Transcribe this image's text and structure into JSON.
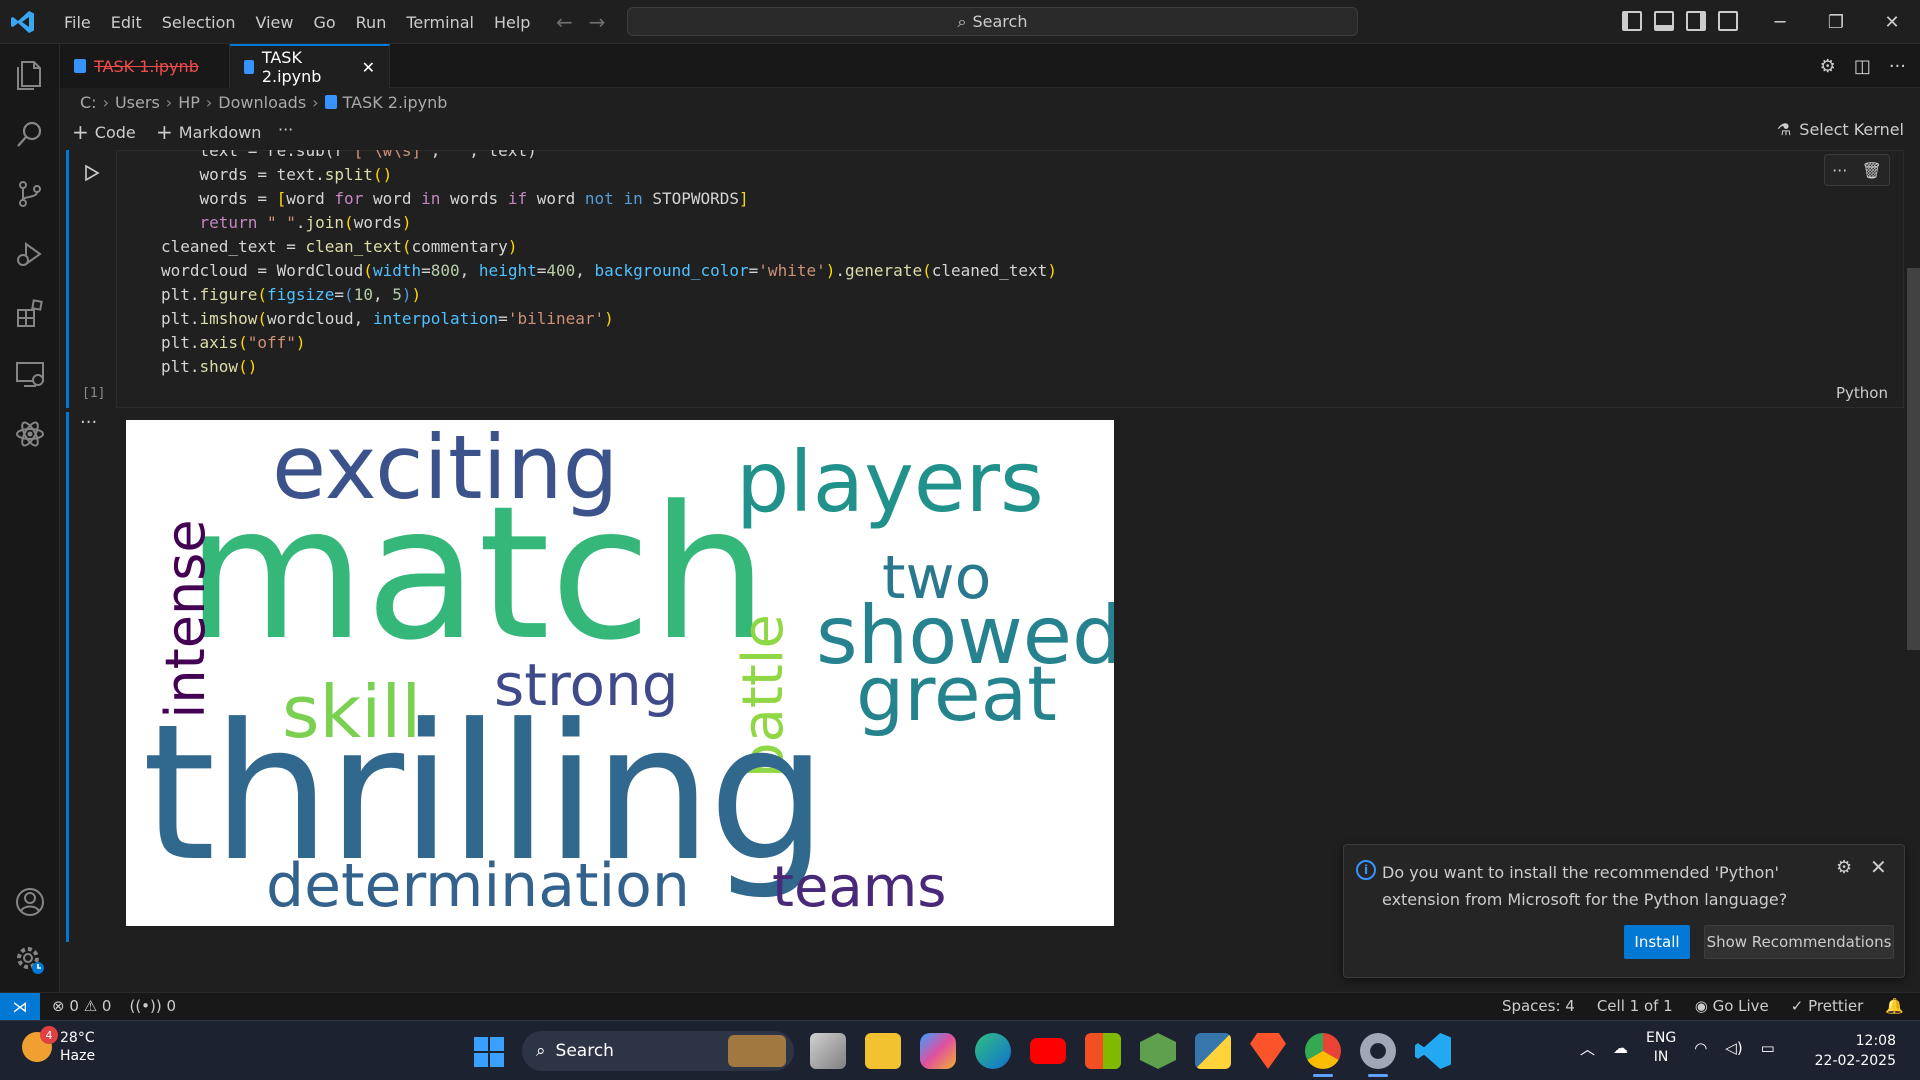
{
  "titlebar": {
    "menu": [
      "File",
      "Edit",
      "Selection",
      "View",
      "Go",
      "Run",
      "Terminal",
      "Help"
    ],
    "search_label": "Search"
  },
  "tabs": [
    {
      "label": "TASK 1.ipynb",
      "state": "error"
    },
    {
      "label": "TASK 2.ipynb",
      "state": "active"
    }
  ],
  "breadcrumb": [
    "C:",
    "Users",
    "HP",
    "Downloads",
    "TASK 2.ipynb"
  ],
  "toolbar": {
    "code_label": "Code",
    "markdown_label": "Markdown",
    "more_label": "···",
    "kernel_label": "Select Kernel"
  },
  "cell": {
    "exec_count": "[1]",
    "language": "Python",
    "code_lines": [
      "    text = re.sub(r'[^\\w\\s]', '', text)",
      "    words = text.split()",
      "    words = [word for word in words if word not in STOPWORDS]",
      "    return \" \".join(words)",
      "cleaned_text = clean_text(commentary)",
      "wordcloud = WordCloud(width=800, height=400, background_color='white').generate(cleaned_text)",
      "plt.figure(figsize=(10, 5))",
      "plt.imshow(wordcloud, interpolation='bilinear')",
      "plt.axis(\"off\")",
      "plt.show()"
    ]
  },
  "output": {
    "dots": "···",
    "wordcloud_words": [
      {
        "text": "match",
        "color": "#35b779"
      },
      {
        "text": "thrilling",
        "color": "#31688e"
      },
      {
        "text": "exciting",
        "color": "#3b528b"
      },
      {
        "text": "players",
        "color": "#21918c"
      },
      {
        "text": "showed",
        "color": "#26828e"
      },
      {
        "text": "two",
        "color": "#2a788e"
      },
      {
        "text": "great",
        "color": "#25838e"
      },
      {
        "text": "intense",
        "color": "#440154"
      },
      {
        "text": "strong",
        "color": "#3e4a89"
      },
      {
        "text": "skill",
        "color": "#7ad151"
      },
      {
        "text": "battle",
        "color": "#8fd744"
      },
      {
        "text": "determination",
        "color": "#33638d"
      },
      {
        "text": "teams",
        "color": "#482878"
      }
    ]
  },
  "notification": {
    "message": "Do you want to install the recommended 'Python' extension from Microsoft for the Python language?",
    "install_label": "Install",
    "show_rec_label": "Show Recommendations"
  },
  "statusbar": {
    "errors": "0",
    "warnings": "0",
    "ports": "0",
    "spaces": "Spaces: 4",
    "cell": "Cell 1 of 1",
    "golive": "Go Live",
    "prettier": "Prettier"
  },
  "taskbar": {
    "weather_badge": "4",
    "temperature": "28°C",
    "condition": "Haze",
    "search_label": "Search",
    "lang_top": "ENG",
    "lang_bottom": "IN",
    "time": "12:08",
    "date": "22-02-2025"
  },
  "colors": {
    "accent": "#0078d4",
    "error_tab": "#f14c4c"
  }
}
